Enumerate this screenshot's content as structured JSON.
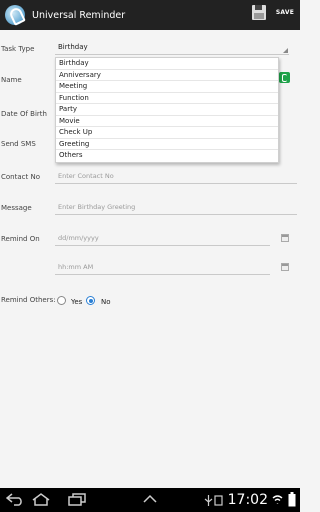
{
  "app": {
    "title": "Universal Reminder",
    "save_label": "SAVE"
  },
  "form": {
    "task_type": {
      "label": "Task Type",
      "value": "Birthday"
    },
    "name": {
      "label": "Name"
    },
    "dob": {
      "label": "Date Of Birth"
    },
    "send_sms": {
      "label": "Send SMS"
    },
    "contact_no": {
      "label": "Contact No",
      "placeholder": "Enter Contact No"
    },
    "message": {
      "label": "Message",
      "placeholder": "Enter Birthday Greeting"
    },
    "remind_on": {
      "label": "Remind On",
      "date_placeholder": "dd/mm/yyyy",
      "time_placeholder": "hh:mm AM"
    },
    "remind_others": {
      "label": "Remind Others:",
      "yes": "Yes",
      "no": "No",
      "selected": "No"
    }
  },
  "dropdown": {
    "options": [
      "Birthday",
      "Anniversary",
      "Meeting",
      "Function",
      "Party",
      "Movie",
      "Check Up",
      "Greeting",
      "Others"
    ]
  },
  "statusbar": {
    "time": "17:02"
  },
  "colors": {
    "actionbar": "#222222",
    "accent": "#2a7fd4",
    "phone": "#1fa34a"
  },
  "icons": [
    "app-logo-icon",
    "save-disk-icon",
    "phone-icon",
    "calendar-icon",
    "clock-icon",
    "back-icon",
    "home-icon",
    "recent-apps-icon",
    "usb-icon",
    "wifi-icon",
    "battery-icon"
  ]
}
